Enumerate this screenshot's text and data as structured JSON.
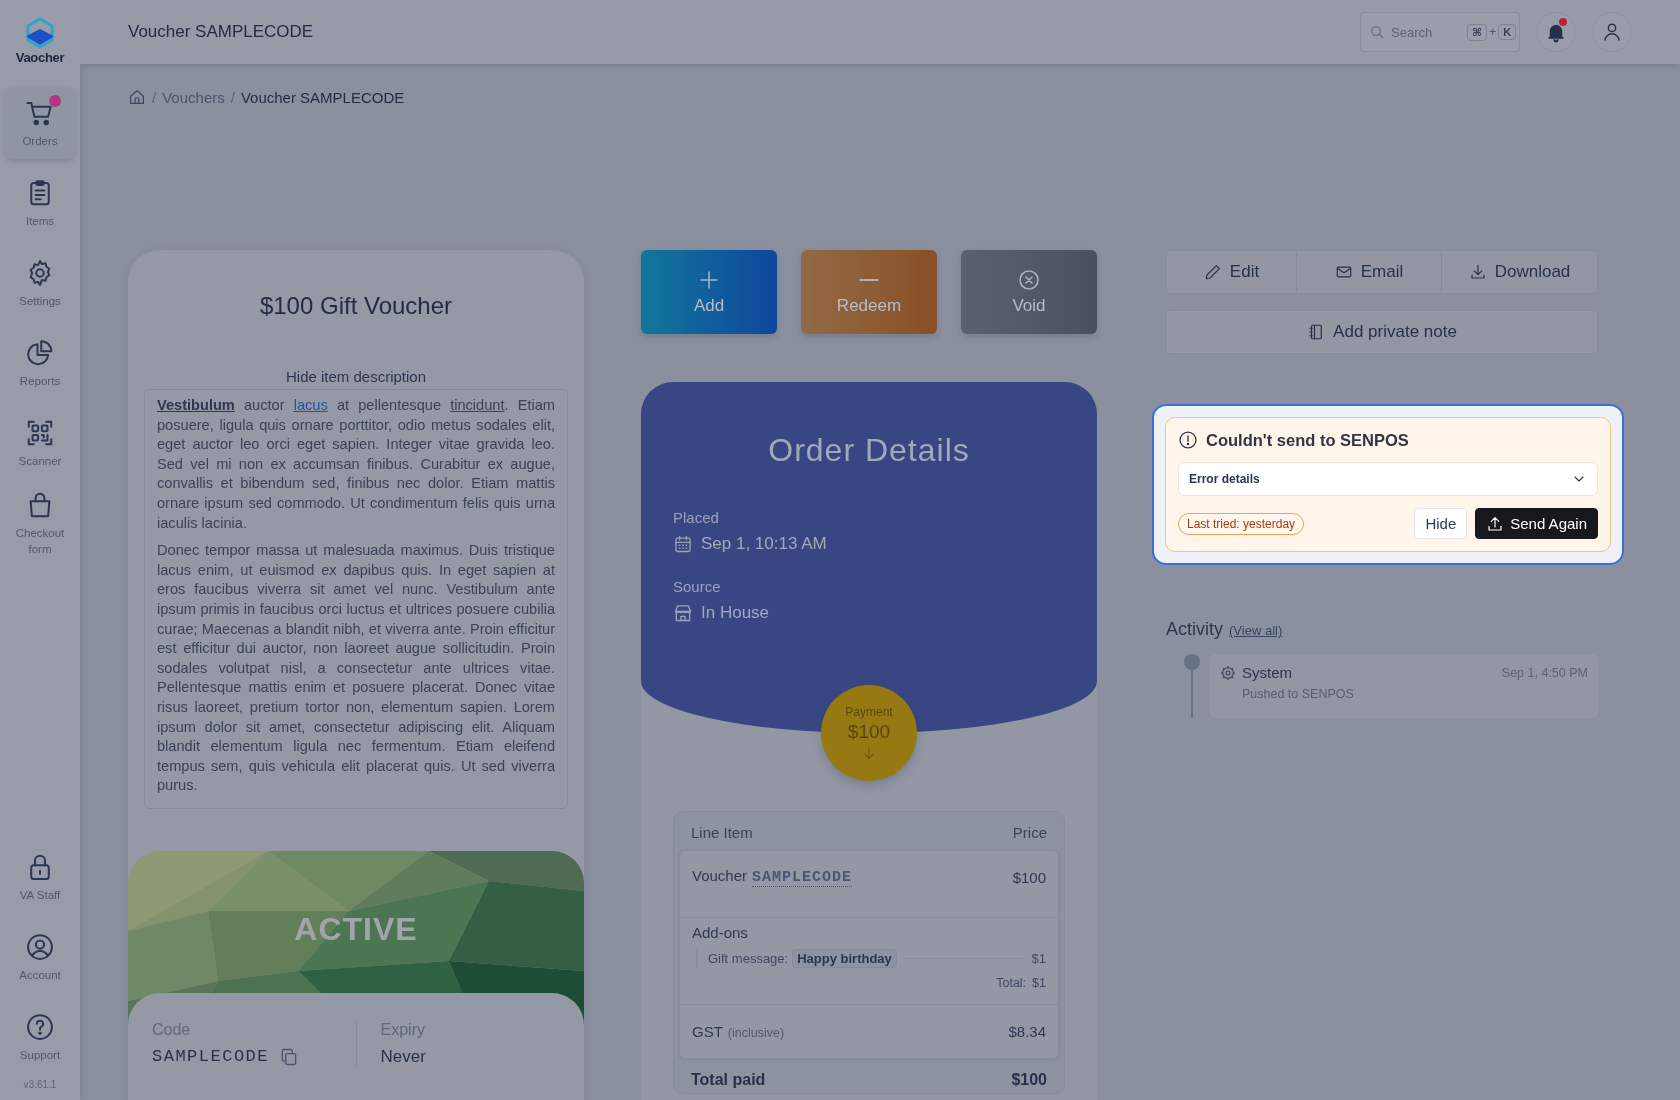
{
  "app": {
    "logo_text": "Vaocher",
    "version": "v3.61.1"
  },
  "sidebar": {
    "items": [
      {
        "label": "Orders",
        "selected": true,
        "notification": true
      },
      {
        "label": "Items",
        "selected": false,
        "notification": false
      },
      {
        "label": "Settings",
        "selected": false,
        "notification": false
      },
      {
        "label": "Reports",
        "selected": false,
        "notification": false
      },
      {
        "label": "Scanner",
        "selected": false,
        "notification": false
      },
      {
        "label": "Checkout form",
        "selected": false,
        "notification": false
      }
    ],
    "bottom_items": [
      {
        "label": "VA Staff"
      },
      {
        "label": "Account"
      },
      {
        "label": "Support"
      }
    ]
  },
  "header": {
    "title": "Voucher SAMPLECODE",
    "search": {
      "placeholder": "Search",
      "keys": [
        "⌘",
        "+",
        "K"
      ]
    },
    "notifications_unread": true
  },
  "breadcrumb": [
    {
      "separator": "/",
      "label": "Vouchers",
      "current": false
    },
    {
      "separator": "/",
      "label": "Voucher SAMPLECODE",
      "current": true
    }
  ],
  "voucher_card": {
    "title": "$100 Gift Voucher",
    "toggle": "Hide item description",
    "description": [
      [
        {
          "kind": "strong",
          "text": "Vestibulum"
        },
        {
          "kind": "plain",
          "text": " auctor "
        },
        {
          "kind": "link",
          "text": "lacus"
        },
        {
          "kind": "plain",
          "text": " at pellentesque "
        },
        {
          "kind": "underline",
          "text": "tincidunt"
        },
        {
          "kind": "plain",
          "text": ". Etiam posuere, ligula quis ornare porttitor, odio metus sodales elit, eget auctor leo orci eget sapien. Integer vitae gravida leo. Sed vel mi non ex accumsan finibus. Curabitur ex augue, convallis et bibendum sed, finibus nec dolor. Etiam mattis ornare ipsum sed commodo. Ut condimentum felis quis urna iaculis lacinia."
        }
      ],
      [
        {
          "kind": "plain",
          "text": "Donec tempor massa ut malesuada maximus. Duis tristique lacus enim, ut euismod ex dapibus quis. In eget sapien at eros faucibus viverra sit amet vel nunc. Vestibulum ante ipsum primis in faucibus orci luctus et ultrices posuere cubilia curae; Maecenas a blandit nibh, et viverra ante. Proin efficitur est efficitur dui auctor, non laoreet augue sollicitudin. Proin sodales volutpat nisl, a consectetur ante ultrices vitae. Pellentesque mattis enim et posuere placerat. Donec vitae risus laoreet, pretium tortor non, elementum sapien. Lorem ipsum dolor sit amet, consectetur adipiscing elit. Aliquam blandit elementum ligula nec fermentum. Etiam eleifend tempus sem, quis vehicula elit placerat quis. Ut sed viverra purus."
        }
      ]
    ],
    "status": "ACTIVE",
    "code_label": "Code",
    "code": "SAMPLECODE",
    "expiry_label": "Expiry",
    "expiry": "Never"
  },
  "actions": [
    {
      "label": "Add",
      "kind": "add"
    },
    {
      "label": "Redeem",
      "kind": "redeem"
    },
    {
      "label": "Void",
      "kind": "void"
    }
  ],
  "order": {
    "title": "Order Details",
    "fields": [
      {
        "label": "Placed",
        "value": "Sep 1, 10:13 AM",
        "kind": "date"
      },
      {
        "label": "Source",
        "value": "In House",
        "kind": "store"
      }
    ],
    "payment": {
      "label": "Payment",
      "amount": "$100"
    },
    "line_items": {
      "columns": [
        "Line Item",
        "Price"
      ],
      "item": {
        "label": "Voucher",
        "code": "SAMPLECODE",
        "price": "$100"
      },
      "addons_title": "Add-ons",
      "addons": [
        {
          "label": "Gift message:",
          "value": "Happy birthday",
          "price": "$1"
        }
      ],
      "addons_total_label": "Total:",
      "addons_total": "$1",
      "tax": {
        "label": "GST",
        "note": "(inclusive)",
        "amount": "$8.34"
      },
      "total": {
        "label": "Total paid",
        "amount": "$100"
      }
    }
  },
  "toolbar": [
    {
      "label": "Edit",
      "kind": "edit"
    },
    {
      "label": "Email",
      "kind": "email"
    },
    {
      "label": "Download",
      "kind": "download"
    }
  ],
  "note_button": "Add private note",
  "alert": {
    "title": "Couldn't send to SENPOS",
    "details": "Error details",
    "details_expanded": false,
    "last_tried": "Last tried: yesterday",
    "buttons": [
      {
        "label": "Hide",
        "kind": "secondary"
      },
      {
        "label": "Send Again",
        "kind": "primary"
      }
    ]
  },
  "activity": {
    "title": "Activity",
    "link": "(View all)",
    "entries": [
      {
        "actor": "System",
        "time": "Sep 1, 4:50 PM",
        "text": "Pushed to SENPOS"
      }
    ]
  }
}
